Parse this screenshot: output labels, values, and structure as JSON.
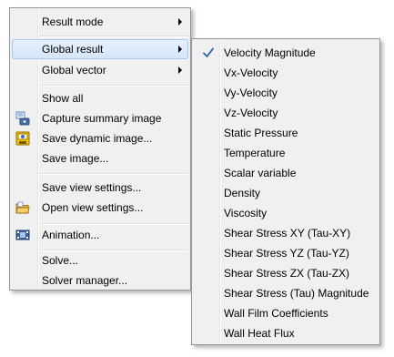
{
  "main_menu": {
    "result_mode": "Result mode",
    "global_result": "Global result",
    "global_vector": "Global vector",
    "show_all": "Show all",
    "capture_summary": "Capture summary image",
    "save_dynamic": "Save dynamic image...",
    "save_image": "Save image...",
    "save_view": "Save view settings...",
    "open_view": "Open view settings...",
    "animation": "Animation...",
    "solve": "Solve...",
    "solver_manager": "Solver manager..."
  },
  "sub_menu": {
    "checked_item": "Velocity Magnitude",
    "items": [
      "Velocity Magnitude",
      "Vx-Velocity",
      "Vy-Velocity",
      "Vz-Velocity",
      "Static Pressure",
      "Temperature",
      "Scalar variable",
      "Density",
      "Viscosity",
      "Shear Stress XY (Tau-XY)",
      "Shear Stress YZ (Tau-YZ)",
      "Shear Stress ZX (Tau-ZX)",
      "Shear Stress (Tau) Magnitude",
      "Wall Film Coefficients",
      "Wall Heat Flux"
    ]
  },
  "colors": {
    "menu_background": "#f0f0f0",
    "menu_border": "#979797",
    "highlight_fill": "#d5e6f9",
    "highlight_border": "#a8c8ef",
    "checkmark": "#2c5ea8"
  },
  "icons": {
    "capture_summary": "camera-summary-icon",
    "save_dynamic": "save-dynamic-image-icon",
    "open_view": "open-folder-icon",
    "animation": "film-strip-icon",
    "checked": "checkmark-icon",
    "submenu_arrow": "chevron-right-icon"
  }
}
